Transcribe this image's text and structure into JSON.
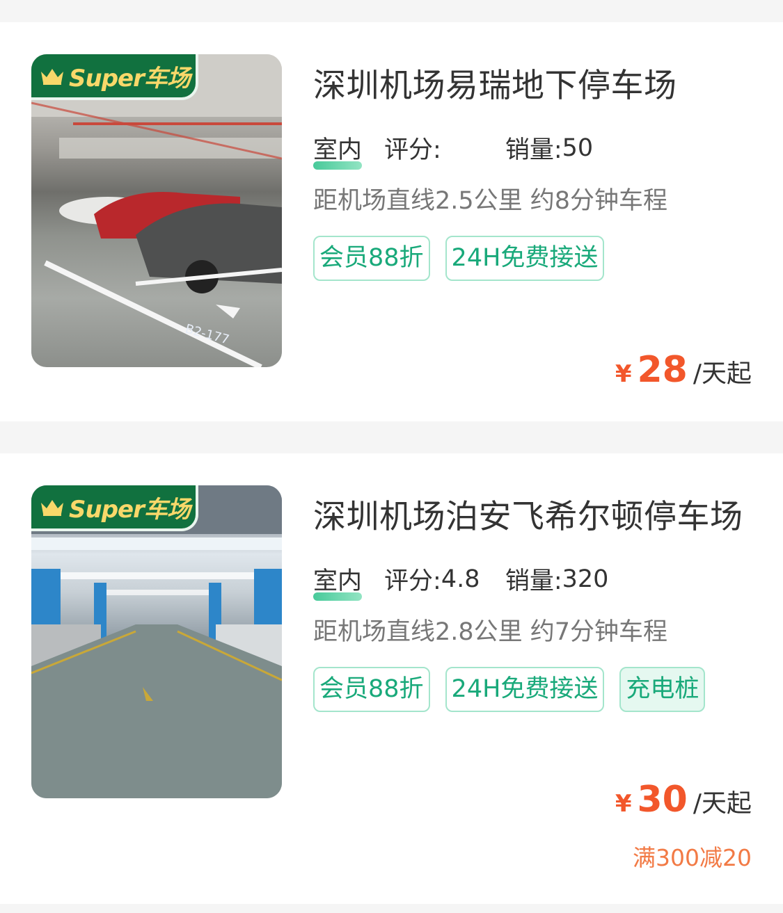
{
  "badge": {
    "text": "Super车场"
  },
  "lots": [
    {
      "name": "深圳机场易瑞地下停车场",
      "type": "室内",
      "rating_label": "评分:",
      "rating": "",
      "sales_label": "销量:",
      "sales": "50",
      "distance": "距机场直线2.5公里 约8分钟车程",
      "tags": [
        "会员88折",
        "24H免费接送"
      ],
      "currency": "¥",
      "price": "28",
      "price_unit": "/天起"
    },
    {
      "name": "深圳机场泊安飞希尔顿停车场",
      "type": "室内",
      "rating_label": "评分:",
      "rating": "4.8",
      "sales_label": "销量:",
      "sales": "320",
      "distance": "距机场直线2.8公里 约7分钟车程",
      "tags": [
        "会员88折",
        "24H免费接送",
        "充电桩"
      ],
      "currency": "¥",
      "price": "30",
      "price_unit": "/天起",
      "discount": "满300减20"
    }
  ],
  "colors": {
    "brand_green": "#11713f",
    "accent_orange": "#f2572b",
    "tag_green": "#19a97a"
  }
}
